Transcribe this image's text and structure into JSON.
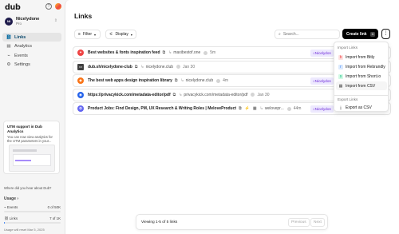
{
  "app": {
    "logo": "dub"
  },
  "workspace": {
    "name": "Nicelydone",
    "plan": "Pro",
    "initials": "NI"
  },
  "nav": [
    {
      "label": "Links",
      "icon": "link-icon",
      "glyph": "🔗",
      "active": true
    },
    {
      "label": "Analytics",
      "icon": "chart-icon",
      "glyph": "📊",
      "active": false
    },
    {
      "label": "Events",
      "icon": "events-icon",
      "glyph": "⚡",
      "active": false
    },
    {
      "label": "Settings",
      "icon": "gear-icon",
      "glyph": "⚙",
      "active": false
    }
  ],
  "promo": {
    "title": "UTM support in Dub Analytics",
    "text": "You can now view analytics for the UTM parameters in your..."
  },
  "heard": "Where did you hear about Dub?",
  "usage": {
    "title": "Usage",
    "events_label": "Events",
    "events_value": "0 of 50K",
    "events_fraction": 0.0,
    "links_label": "Links",
    "links_value": "7 of 1K",
    "links_fraction": 0.007,
    "limit_text": "Usage will reset Mar 5, 2025"
  },
  "header": {
    "title": "Links",
    "filter_label": "Filter",
    "display_label": "Display",
    "search_placeholder": "Search...",
    "create_label": "Create link",
    "create_shortcut": "C",
    "more_label": "⋮"
  },
  "links": [
    {
      "title": "Best websites & fonts inspiration feed",
      "dest": "maxibestof.one",
      "ago": "5m",
      "tag": "Nicelydon",
      "favicon_color": "#ef4444",
      "favicon_glyph": "✦"
    },
    {
      "title": "dub.sh/nicelydone-club",
      "dest": "nicelydone.club",
      "ago": "Jan 30",
      "tag": "",
      "favicon_color": "#404040",
      "favicon_glyph": "▭"
    },
    {
      "title": "The best web apps design inspiration library",
      "dest": "nicelydone.club",
      "ago": "4m",
      "tag": "Nicelydon",
      "favicon_color": "#f97316",
      "favicon_glyph": "◆"
    },
    {
      "title": "https://privacykick.com/metadata-editor/pdf",
      "dest": "privacykick.com/metadata-editor/pdf",
      "ago": "Jan 30",
      "tag": "",
      "favicon_color": "#2563eb",
      "favicon_glyph": "◉"
    },
    {
      "title": "Product Jobs: Find Design, PM, UX Research & Writing Roles | MeloveProduct",
      "dest": "welovepr...",
      "ago": "44m",
      "tag": "Nicelydon",
      "favicon_color": "#6366f1",
      "favicon_glyph": "✿"
    }
  ],
  "menu": {
    "import_title": "Import Links",
    "items": [
      {
        "label": "Import from Bitly",
        "color": "#ef4444"
      },
      {
        "label": "Import from Rebrandly",
        "color": "#3b82f6"
      },
      {
        "label": "Import from Short.io",
        "color": "#10b981"
      },
      {
        "label": "Import from CSV",
        "color": "#525252"
      }
    ],
    "export_title": "Export Links",
    "export_item": "Export as CSV"
  },
  "pager": {
    "text": "Viewing 1-5 of 5 links",
    "prev": "Previous",
    "next": "Next"
  }
}
